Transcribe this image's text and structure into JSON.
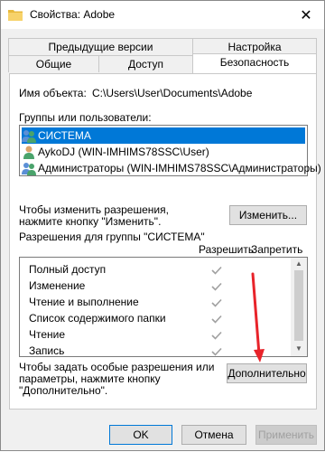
{
  "window": {
    "title": "Свойства: Adobe",
    "close_glyph": "✕"
  },
  "tabs": {
    "row1": [
      {
        "label": "Предыдущие версии"
      },
      {
        "label": "Настройка"
      }
    ],
    "row2": [
      {
        "label": "Общие"
      },
      {
        "label": "Доступ"
      },
      {
        "label": "Безопасность",
        "active": true
      }
    ]
  },
  "object": {
    "label": "Имя объекта:",
    "path": "C:\\Users\\User\\Documents\\Adobe"
  },
  "groups": {
    "label": "Группы или пользователи:",
    "items": [
      {
        "name": "СИСТЕМА",
        "selected": true,
        "icon": "users-group-icon"
      },
      {
        "name": "AykoDJ (WIN-IMHIMS78SSC\\User)",
        "selected": false,
        "icon": "user-icon"
      },
      {
        "name": "Администраторы (WIN-IMHIMS78SSC\\Администраторы)",
        "selected": false,
        "icon": "users-group-icon"
      }
    ]
  },
  "change_hint": {
    "line1": "Чтобы изменить разрешения,",
    "line2": "нажмите кнопку \"Изменить\".",
    "button": "Изменить..."
  },
  "permissions": {
    "label": "Разрешения для группы \"СИСТЕМА\"",
    "col_allow": "Разрешить",
    "col_deny": "Запретить",
    "rows": [
      {
        "name": "Полный доступ",
        "allow": true,
        "deny": false
      },
      {
        "name": "Изменение",
        "allow": true,
        "deny": false
      },
      {
        "name": "Чтение и выполнение",
        "allow": true,
        "deny": false
      },
      {
        "name": "Список содержимого папки",
        "allow": true,
        "deny": false
      },
      {
        "name": "Чтение",
        "allow": true,
        "deny": false
      },
      {
        "name": "Запись",
        "allow": true,
        "deny": false
      }
    ]
  },
  "advanced_hint": {
    "line1": "Чтобы задать особые разрешения или",
    "line2": "параметры, нажмите кнопку",
    "line3": "\"Дополнительно\".",
    "button": "Дополнительно"
  },
  "footer": {
    "ok": "OK",
    "cancel": "Отмена",
    "apply": "Применить"
  },
  "colors": {
    "accent": "#0078d7",
    "annotation_arrow": "#e8232a",
    "check_gray": "#a0a0a0"
  }
}
